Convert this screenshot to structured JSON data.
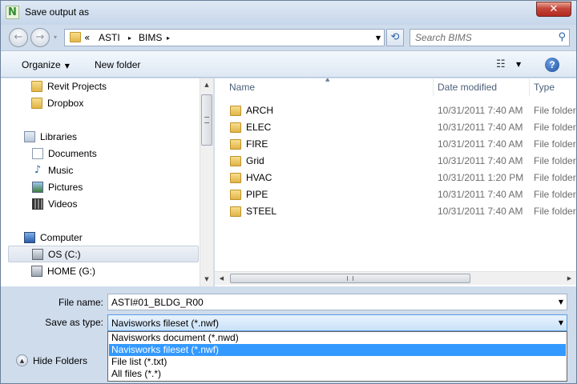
{
  "window": {
    "title": "Save output as",
    "app_icon_letter": "N",
    "close_glyph": "✕"
  },
  "address": {
    "overflow": "«",
    "crumbs": [
      "ASTI",
      "BIMS"
    ],
    "separator": "▸",
    "dropdown_glyph": "▼",
    "refresh_glyph": "⟲"
  },
  "search": {
    "placeholder": "Search BIMS",
    "icon_glyph": "⚲"
  },
  "nav_buttons": {
    "back_glyph": "←",
    "forward_glyph": "→",
    "recent_glyph": "▾"
  },
  "toolbar": {
    "organize_label": "Organize",
    "organize_arrow": "▼",
    "new_folder_label": "New folder",
    "view_glyph": "☷",
    "view_arrow": "▼",
    "help_glyph": "?"
  },
  "navpane": {
    "items": [
      {
        "label": "Revit Projects",
        "icon": "folder-icon"
      },
      {
        "label": "Dropbox",
        "icon": "folder-icon"
      },
      {
        "label": "Libraries",
        "icon": "library-icon"
      },
      {
        "label": "Documents",
        "icon": "documents-icon"
      },
      {
        "label": "Music",
        "icon": "music-icon",
        "glyph": "♪"
      },
      {
        "label": "Pictures",
        "icon": "pictures-icon"
      },
      {
        "label": "Videos",
        "icon": "videos-icon"
      },
      {
        "label": "Computer",
        "icon": "computer-icon"
      },
      {
        "label": "OS (C:)",
        "icon": "drive-icon",
        "selected": true
      },
      {
        "label": "HOME (G:)",
        "icon": "network-drive-icon"
      }
    ],
    "scroll_up_glyph": "▲",
    "scroll_down_glyph": "▼"
  },
  "filelist": {
    "sort_glyph": "▲",
    "columns": [
      "Name",
      "Date modified",
      "Type"
    ],
    "rows": [
      {
        "name": "ARCH",
        "date": "10/31/2011 7:40 AM",
        "type": "File folder"
      },
      {
        "name": "ELEC",
        "date": "10/31/2011 7:40 AM",
        "type": "File folder"
      },
      {
        "name": "FIRE",
        "date": "10/31/2011 7:40 AM",
        "type": "File folder"
      },
      {
        "name": "Grid",
        "date": "10/31/2011 7:40 AM",
        "type": "File folder"
      },
      {
        "name": "HVAC",
        "date": "10/31/2011 1:20 PM",
        "type": "File folder"
      },
      {
        "name": "PIPE",
        "date": "10/31/2011 7:40 AM",
        "type": "File folder"
      },
      {
        "name": "STEEL",
        "date": "10/31/2011 7:40 AM",
        "type": "File folder"
      }
    ],
    "scroll_left_glyph": "◀",
    "scroll_right_glyph": "▶"
  },
  "form": {
    "filename_label": "File name:",
    "filename_value": "ASTI#01_BLDG_R00",
    "saveas_label": "Save as type:",
    "saveas_value": "Navisworks fileset (*.nwf)",
    "dropdown_glyph": "▼",
    "options": [
      "Navisworks document (*.nwd)",
      "Navisworks fileset (*.nwf)",
      "File list (*.txt)",
      "All files (*.*)"
    ],
    "selected_option": 1
  },
  "footer": {
    "hide_folders_label": "Hide Folders",
    "hide_folders_glyph": "▲"
  },
  "colors": {
    "selection_blue": "#3399ff",
    "frame": "#cfdcec",
    "close_red": "#c4463a"
  }
}
